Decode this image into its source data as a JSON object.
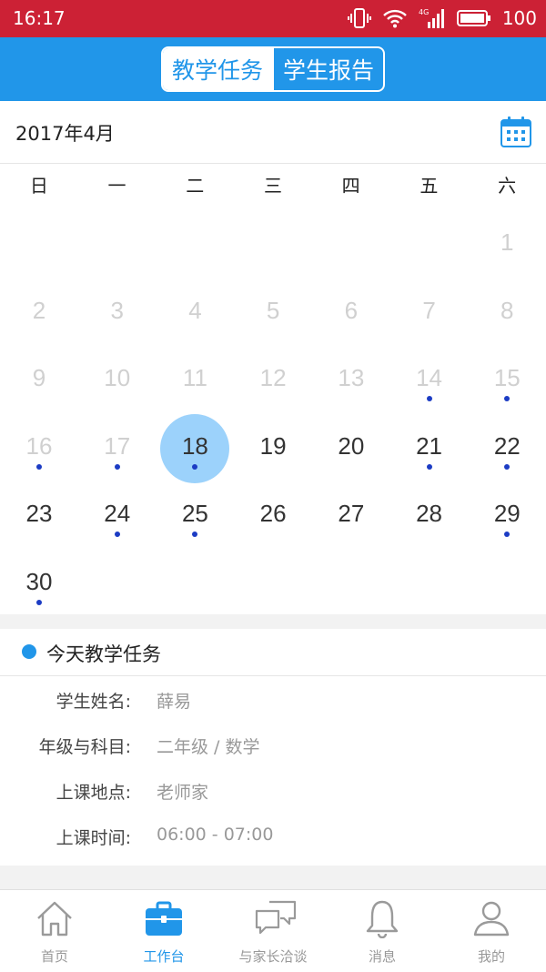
{
  "status_bar": {
    "time": "16:17",
    "battery": "100",
    "network": "4G"
  },
  "header": {
    "tabs": [
      {
        "label": "教学任务",
        "active": true
      },
      {
        "label": "学生报告",
        "active": false
      }
    ]
  },
  "calendar": {
    "month_label": "2017年4月",
    "weekdays": [
      "日",
      "一",
      "二",
      "三",
      "四",
      "五",
      "六"
    ],
    "selected_day": "18",
    "days": [
      {
        "n": "1",
        "muted": true,
        "dot": false
      },
      {
        "n": "2",
        "muted": true,
        "dot": false
      },
      {
        "n": "3",
        "muted": true,
        "dot": false
      },
      {
        "n": "4",
        "muted": true,
        "dot": false
      },
      {
        "n": "5",
        "muted": true,
        "dot": false
      },
      {
        "n": "6",
        "muted": true,
        "dot": false
      },
      {
        "n": "7",
        "muted": true,
        "dot": false
      },
      {
        "n": "8",
        "muted": true,
        "dot": false
      },
      {
        "n": "9",
        "muted": true,
        "dot": false
      },
      {
        "n": "10",
        "muted": true,
        "dot": false
      },
      {
        "n": "11",
        "muted": true,
        "dot": false
      },
      {
        "n": "12",
        "muted": true,
        "dot": false
      },
      {
        "n": "13",
        "muted": true,
        "dot": false
      },
      {
        "n": "14",
        "muted": true,
        "dot": true
      },
      {
        "n": "15",
        "muted": true,
        "dot": true
      },
      {
        "n": "16",
        "muted": true,
        "dot": true
      },
      {
        "n": "17",
        "muted": true,
        "dot": true
      },
      {
        "n": "18",
        "muted": false,
        "dot": true
      },
      {
        "n": "19",
        "muted": false,
        "dot": false
      },
      {
        "n": "20",
        "muted": false,
        "dot": false
      },
      {
        "n": "21",
        "muted": false,
        "dot": true
      },
      {
        "n": "22",
        "muted": false,
        "dot": true
      },
      {
        "n": "23",
        "muted": false,
        "dot": false
      },
      {
        "n": "24",
        "muted": false,
        "dot": true
      },
      {
        "n": "25",
        "muted": false,
        "dot": true
      },
      {
        "n": "26",
        "muted": false,
        "dot": false
      },
      {
        "n": "27",
        "muted": false,
        "dot": false
      },
      {
        "n": "28",
        "muted": false,
        "dot": false
      },
      {
        "n": "29",
        "muted": false,
        "dot": true
      },
      {
        "n": "30",
        "muted": false,
        "dot": true
      }
    ]
  },
  "task": {
    "title": "今天教学任务",
    "rows": [
      {
        "label": "学生姓名:",
        "value": "薛易"
      },
      {
        "label": "年级与科目:",
        "value": "二年级 / 数学"
      },
      {
        "label": "上课地点:",
        "value": "老师家"
      },
      {
        "label": "上课时间:",
        "value": "06:00 - 07:00"
      }
    ]
  },
  "tabbar": {
    "items": [
      {
        "label": "首页",
        "icon": "home-icon",
        "active": false
      },
      {
        "label": "工作台",
        "icon": "briefcase-icon",
        "active": true
      },
      {
        "label": "与家长洽谈",
        "icon": "chat-icon",
        "active": false
      },
      {
        "label": "消息",
        "icon": "bell-icon",
        "active": false
      },
      {
        "label": "我的",
        "icon": "user-icon",
        "active": false
      }
    ]
  },
  "colors": {
    "status_bar": "#cc2135",
    "primary": "#2196e9",
    "selected_day": "#9cd2fb",
    "event_dot": "#1c3cc4"
  }
}
